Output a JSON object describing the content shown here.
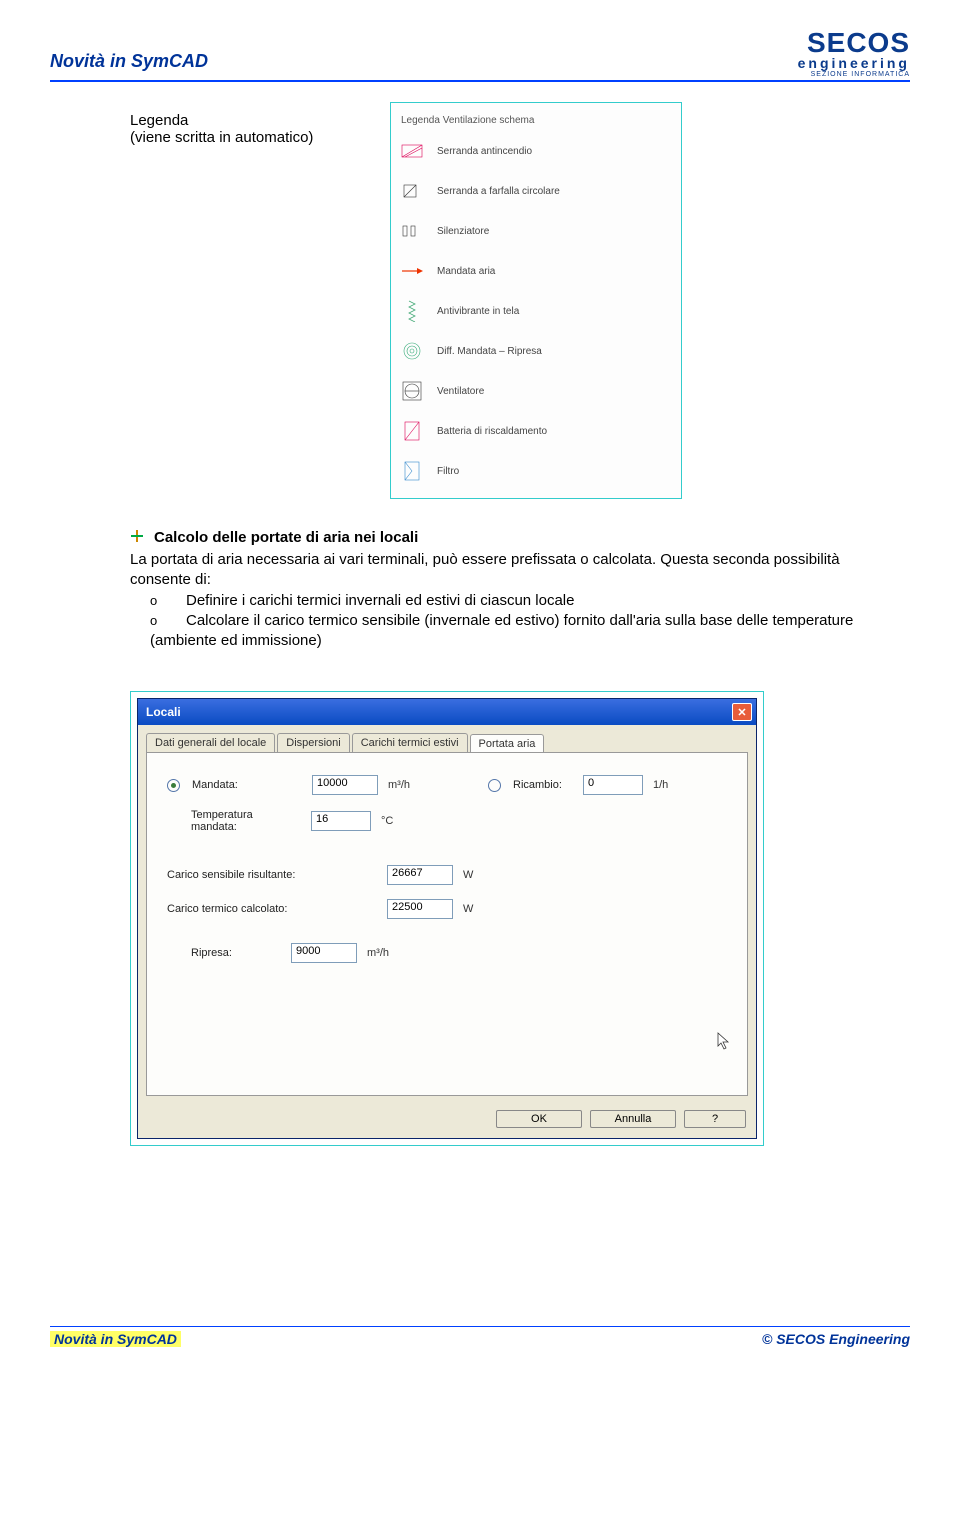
{
  "header": {
    "title": "Novità in SymCAD",
    "logo_main": "SECOS",
    "logo_sub1": "engineering",
    "logo_sub2": "SEZIONE INFORMATICA"
  },
  "caption": {
    "line1": "Legenda",
    "line2": "(viene scritta in automatico)"
  },
  "legend": {
    "title": "Legenda Ventilazione schema",
    "items": [
      {
        "label": "Serranda antincendio"
      },
      {
        "label": "Serranda a farfalla circolare"
      },
      {
        "label": "Silenziatore"
      },
      {
        "label": "Mandata aria"
      },
      {
        "label": "Antivibrante in tela"
      },
      {
        "label": "Diff. Mandata – Ripresa"
      },
      {
        "label": "Ventilatore"
      },
      {
        "label": "Batteria di riscaldamento"
      },
      {
        "label": "Filtro"
      }
    ]
  },
  "section": {
    "heading": "Calcolo delle portate di aria nei locali",
    "para": "La portata di aria necessaria ai vari terminali, può essere prefissata o calcolata. Questa seconda possibilità consente di:",
    "li1": "Definire i carichi termici invernali ed estivi di ciascun locale",
    "li2": "Calcolare il carico termico sensibile (invernale ed estivo) fornito dall'aria sulla base delle temperature (ambiente ed immissione)"
  },
  "dialog": {
    "title": "Locali",
    "tabs": {
      "t1": "Dati generali del locale",
      "t2": "Dispersioni",
      "t3": "Carichi termici estivi",
      "t4": "Portata aria"
    },
    "fields": {
      "mandata_label": "Mandata:",
      "mandata_value": "10000",
      "mandata_unit": "m³/h",
      "ricambio_label": "Ricambio:",
      "ricambio_value": "0",
      "ricambio_unit": "1/h",
      "temp_label": "Temperatura mandata:",
      "temp_value": "16",
      "temp_unit": "°C",
      "carico_sens_label": "Carico sensibile risultante:",
      "carico_sens_value": "26667",
      "carico_sens_unit": "W",
      "carico_calc_label": "Carico termico calcolato:",
      "carico_calc_value": "22500",
      "carico_calc_unit": "W",
      "ripresa_label": "Ripresa:",
      "ripresa_value": "9000",
      "ripresa_unit": "m³/h"
    },
    "buttons": {
      "ok": "OK",
      "cancel": "Annulla",
      "help": "?"
    }
  },
  "footer": {
    "left": "Novità in SymCAD",
    "right": "© SECOS Engineering"
  }
}
